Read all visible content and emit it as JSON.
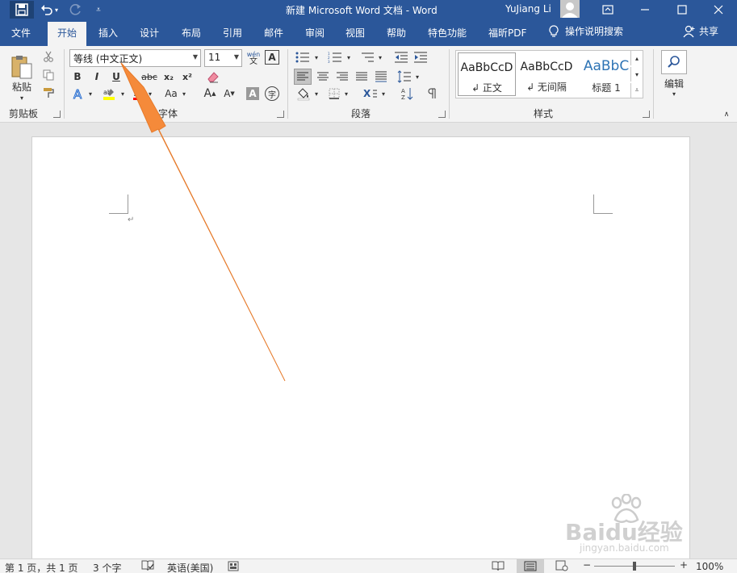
{
  "titlebar": {
    "title": "新建 Microsoft Word 文档  -  Word",
    "user": "YuJiang Li",
    "icons": [
      "save-icon",
      "undo-icon",
      "redo-icon",
      "customize-qat-icon",
      "avatar",
      "ribbon-display-icon",
      "minimize-icon",
      "maximize-icon",
      "close-icon"
    ]
  },
  "tabs": [
    "文件",
    "开始",
    "插入",
    "设计",
    "布局",
    "引用",
    "邮件",
    "审阅",
    "视图",
    "帮助",
    "特色功能",
    "福昕PDF"
  ],
  "active_tab": "开始",
  "tell_me": "操作说明搜索",
  "share": "共享",
  "ribbon": {
    "clipboard": {
      "label": "剪贴板",
      "paste": "粘贴"
    },
    "font": {
      "label": "字体",
      "font_name": "等线 (中文正文)",
      "font_size": "11",
      "pinyin": "wén",
      "bold": "B",
      "italic": "I",
      "underline": "U",
      "strike": "abc",
      "subscript": "x₂",
      "superscript": "x²",
      "grow": "A",
      "shrink": "A",
      "case": "Aa",
      "char_shade": "A",
      "enclose": "字"
    },
    "paragraph": {
      "label": "段落"
    },
    "styles": {
      "label": "样式",
      "items": [
        {
          "preview": "AaBbCcD",
          "name": "↲ 正文"
        },
        {
          "preview": "AaBbCcD",
          "name": "↲ 无间隔"
        },
        {
          "preview": "AaBbC",
          "name": "标题 1"
        }
      ]
    },
    "editing": {
      "label": "编辑"
    }
  },
  "document": {
    "paragraph_mark": "↵"
  },
  "statusbar": {
    "page": "第 1 页，共 1 页",
    "words": "3 个字",
    "language": "英语(美国)",
    "zoom_minus": "−",
    "zoom_plus": "+",
    "zoom": "100%",
    "zoom_level_percent": 100
  },
  "watermark": {
    "brand": "Baidu经验",
    "url": "jingyan.baidu.com"
  },
  "colors": {
    "brand": "#2b579a",
    "highlight": "#ffff00",
    "font_color": "#ff0000",
    "arrow": "#f58a3a"
  }
}
